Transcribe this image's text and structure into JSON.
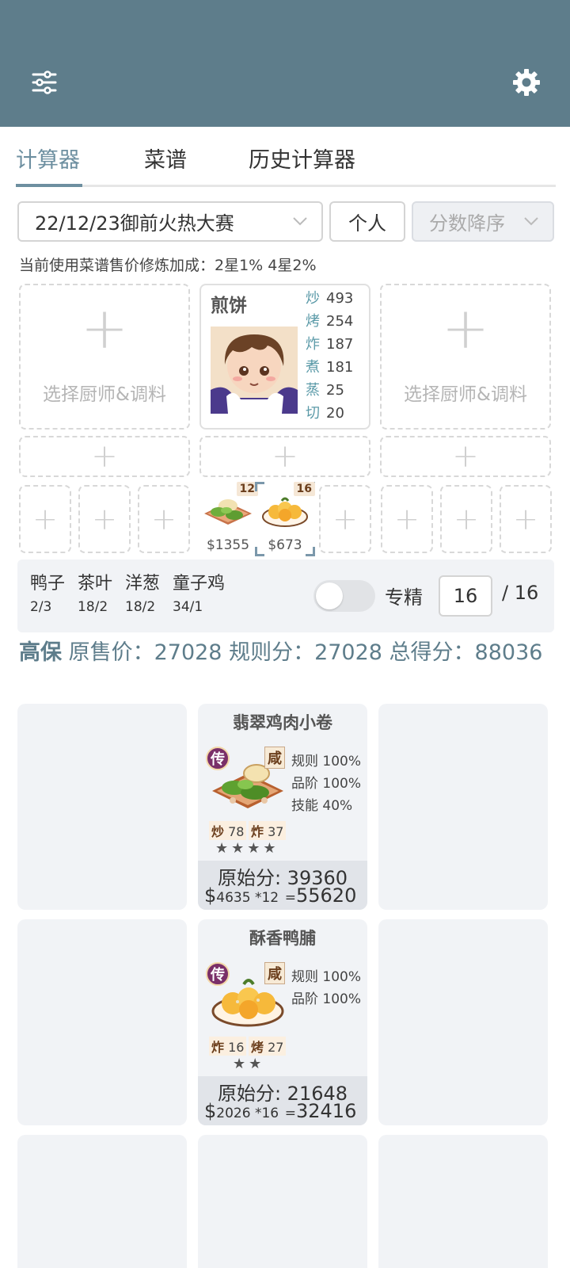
{
  "header": {
    "menu_icon": "sliders-icon",
    "settings_icon": "gear-icon"
  },
  "tabs": [
    {
      "label": "计算器",
      "active": true
    },
    {
      "label": "菜谱",
      "active": false
    },
    {
      "label": "历史计算器",
      "active": false
    }
  ],
  "filters": {
    "contest": "22/12/23御前火热大赛",
    "mode": "个人",
    "sort": "分数降序"
  },
  "bonus_text": "当前使用菜谱售价修炼加成：2星1% 4星2%",
  "chef_slots": {
    "empty_label": "选择厨师&调料",
    "chef": {
      "name": "煎饼",
      "skills": [
        {
          "k": "炒",
          "v": "493"
        },
        {
          "k": "烤",
          "v": "254"
        },
        {
          "k": "炸",
          "v": "187"
        },
        {
          "k": "煮",
          "v": "181"
        },
        {
          "k": "蒸",
          "v": "25"
        },
        {
          "k": "切",
          "v": "20"
        }
      ]
    }
  },
  "dishes": [
    {
      "qty": "12",
      "price": "$1355"
    },
    {
      "qty": "16",
      "price": "$673"
    }
  ],
  "ingredients": [
    {
      "name": "鸭子",
      "count": "2/3"
    },
    {
      "name": "茶叶",
      "count": "18/2"
    },
    {
      "name": "洋葱",
      "count": "18/2"
    },
    {
      "name": "童子鸡",
      "count": "34/1"
    }
  ],
  "specialize": {
    "label": "专精",
    "value": "16",
    "max": "/ 16",
    "enabled": false
  },
  "score": {
    "level": "高保",
    "text": "原售价：27028 规则分：27028 总得分：88036"
  },
  "results": [
    {
      "title": "翡翠鸡肉小卷",
      "badge": "传",
      "taste": "咸",
      "ratios": [
        "规则 100%",
        "品阶 100%",
        "技能 40%"
      ],
      "skills": [
        {
          "k": "炒",
          "v": "78"
        },
        {
          "k": "炸",
          "v": "37"
        }
      ],
      "stars": "★★★★",
      "orig_score": "原始分: 39360",
      "price_calc": {
        "symbol": "$",
        "small": "4635 *12",
        "eq": "=",
        "total": "55620"
      }
    },
    {
      "title": "酥香鸭脯",
      "badge": "传",
      "taste": "咸",
      "ratios": [
        "规则 100%",
        "品阶 100%"
      ],
      "skills": [
        {
          "k": "炸",
          "v": "16"
        },
        {
          "k": "烤",
          "v": "27"
        }
      ],
      "stars": "★★",
      "orig_score": "原始分: 21648",
      "price_calc": {
        "symbol": "$",
        "small": "2026 *16",
        "eq": "=",
        "total": "32416"
      }
    }
  ],
  "colors": {
    "header": "#5e7d8b",
    "accent": "#6d8fa0",
    "panel": "#f1f3f6"
  }
}
